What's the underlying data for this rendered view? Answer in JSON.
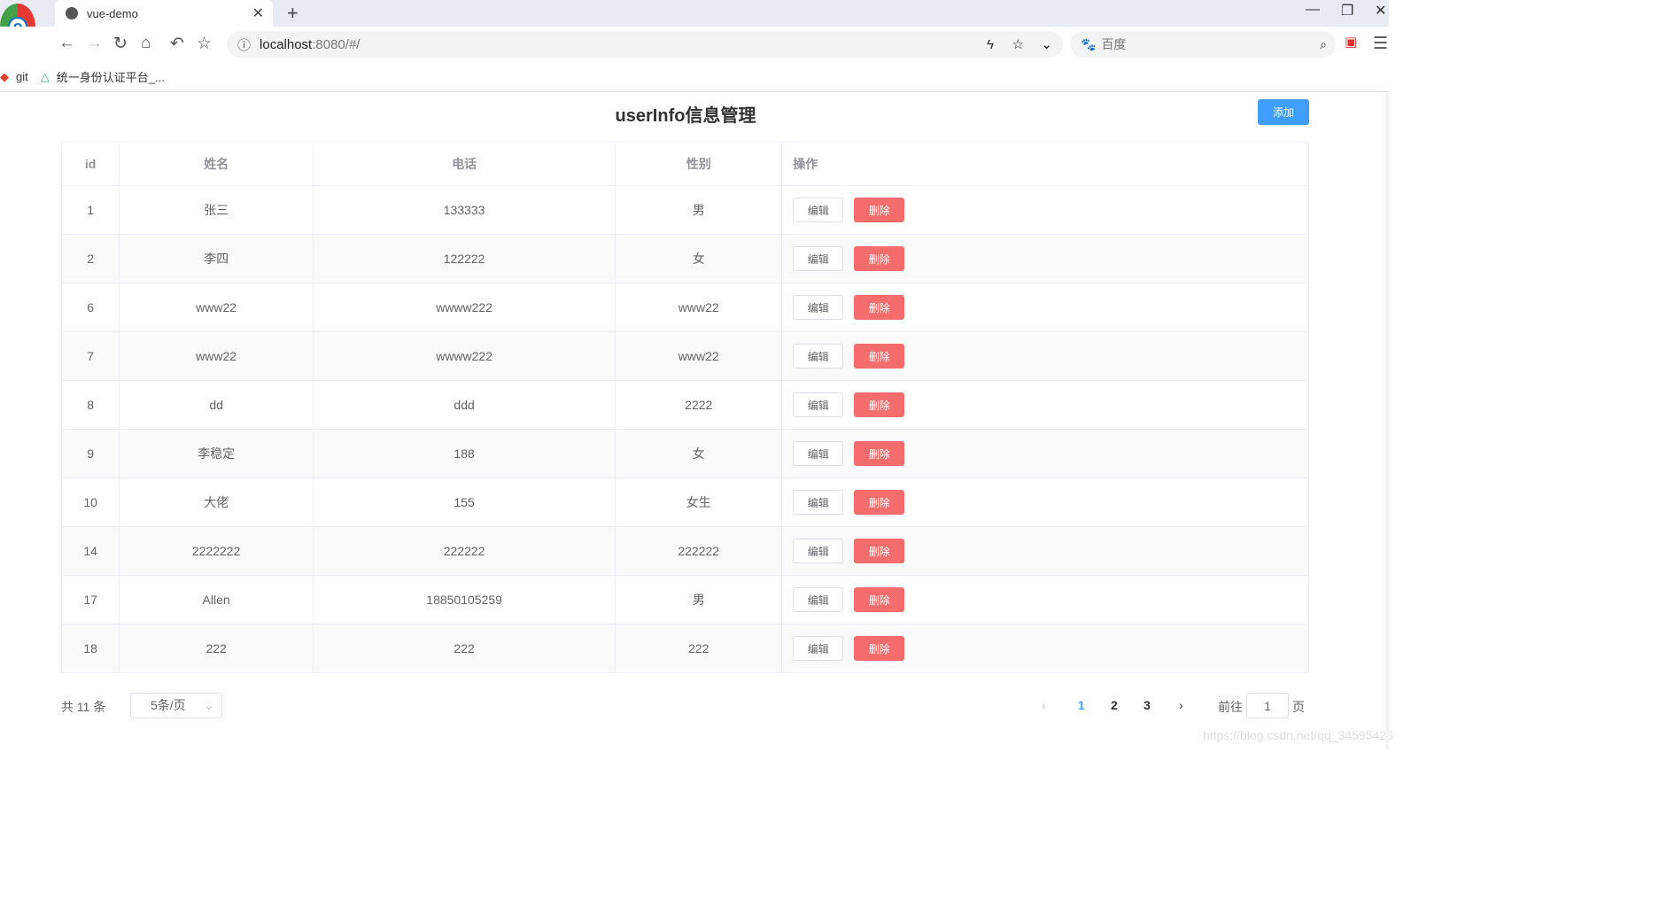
{
  "browser": {
    "tab_title": "vue-demo",
    "url_host": "localhost",
    "url_rest": ":8080/#/",
    "search_placeholder": "百度",
    "bookmarks": [
      {
        "label": "git",
        "icon": "gitlab-icon"
      },
      {
        "label": "统一身份认证平台_...",
        "icon": "vue-icon"
      }
    ]
  },
  "page": {
    "title": "userInfo信息管理",
    "add_label": "添加"
  },
  "table": {
    "headers": [
      "id",
      "姓名",
      "电话",
      "性别",
      "操作"
    ],
    "rows": [
      [
        "1",
        "张三",
        "133333",
        "男"
      ],
      [
        "2",
        "李四",
        "122222",
        "女"
      ],
      [
        "6",
        "www22",
        "wwww222",
        "www22"
      ],
      [
        "7",
        "www22",
        "wwww222",
        "www22"
      ],
      [
        "8",
        "dd",
        "ddd",
        "2222"
      ],
      [
        "9",
        "李稳定",
        "188",
        "女"
      ],
      [
        "10",
        "大佬",
        "155",
        "女生"
      ],
      [
        "14",
        "2222222",
        "222222",
        "222222"
      ],
      [
        "17",
        "Allen",
        "18850105259",
        "男"
      ],
      [
        "18",
        "222",
        "222",
        "222"
      ]
    ],
    "edit_label": "编辑",
    "delete_label": "删除"
  },
  "pagination": {
    "total": "共 11 条",
    "page_size": "5条/页",
    "pages": [
      "1",
      "2",
      "3"
    ],
    "current": "1",
    "goto_label": "前往",
    "goto_value": "1",
    "page_unit": "页",
    "accent": "#409eff"
  },
  "watermark": "https://blog.csdn.net/qq_34595425"
}
